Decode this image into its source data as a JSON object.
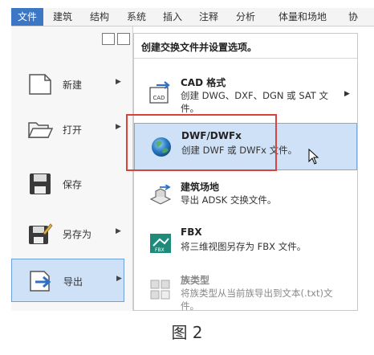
{
  "tabs": [
    "文件",
    "建筑",
    "结构",
    "系统",
    "插入",
    "注释",
    "分析",
    "体量和场地",
    "协"
  ],
  "active_tab": "文件",
  "left_menu": [
    {
      "label": "新建",
      "has_arrow": true,
      "icon": "new-file-icon"
    },
    {
      "label": "打开",
      "has_arrow": true,
      "icon": "open-folder-icon"
    },
    {
      "label": "保存",
      "has_arrow": false,
      "icon": "save-disk-icon"
    },
    {
      "label": "另存为",
      "has_arrow": true,
      "icon": "save-as-icon"
    },
    {
      "label": "导出",
      "has_arrow": true,
      "icon": "export-icon"
    }
  ],
  "submenu": {
    "header": "创建交换文件并设置选项。",
    "items": [
      {
        "title": "CAD 格式",
        "desc": "创建 DWG、DXF、DGN 或 SAT 文件。",
        "has_arrow": true,
        "icon": "cad-icon"
      },
      {
        "title": "DWF/DWFx",
        "desc": "创建 DWF 或 DWFx 文件。",
        "has_arrow": false,
        "icon": "globe-icon"
      },
      {
        "title": "建筑场地",
        "desc": "导出 ADSK 交换文件。",
        "has_arrow": false,
        "icon": "site-icon"
      },
      {
        "title": "FBX",
        "desc": "将三维视图另存为 FBX 文件。",
        "has_arrow": false,
        "icon": "fbx-icon"
      },
      {
        "title": "族类型",
        "desc": "将族类型从当前族导出到文本(.txt)文件。",
        "has_arrow": false,
        "icon": "family-types-icon"
      }
    ]
  },
  "caption": "图 2",
  "colors": {
    "accent": "#3d76c4",
    "highlight": "#d9433e",
    "hover": "#cfe1f7"
  }
}
